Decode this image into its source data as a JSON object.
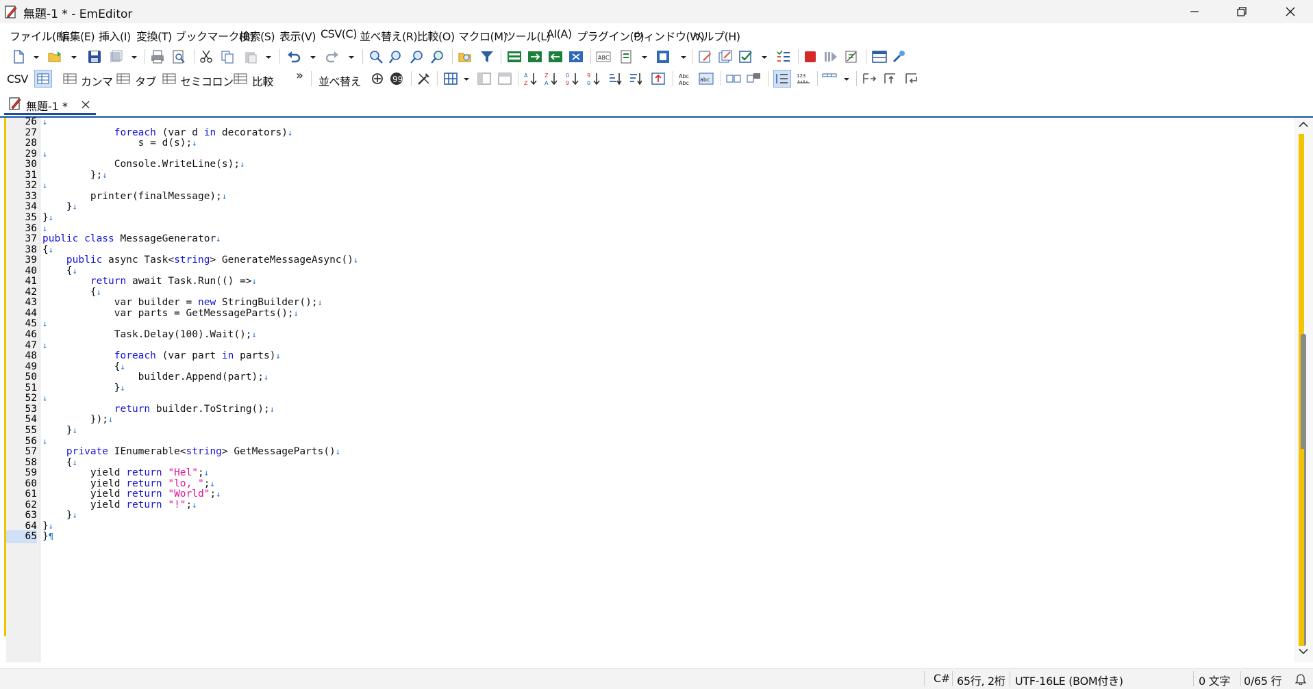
{
  "window": {
    "title": "無題-1 * - EmEditor"
  },
  "menu": [
    "ファイル(F)",
    "編集(E)",
    "挿入(I)",
    "変換(T)",
    "ブックマーク(B)",
    "検索(S)",
    "表示(V)",
    "CSV(C)",
    "並べ替え(R)",
    "比較(O)",
    "マクロ(M)",
    "ツール(L)",
    "AI(A)",
    "プラグイン(P)",
    "ウィンドウ(W)",
    "ヘルプ(H)"
  ],
  "csv_toolbar": {
    "csv_label": "CSV",
    "comma": "カンマ",
    "tab": "タブ",
    "semicolon": "セミコロン",
    "compare": "比較",
    "more": "»",
    "sort_label": "並べ替え"
  },
  "tab": {
    "label": "無題-1 *"
  },
  "editor": {
    "lines": [
      {
        "n": "26",
        "html": ""
      },
      {
        "n": "27",
        "html": "            <span class=\"kw\">foreach</span> (var d <span class=\"kw\">in</span> decorators)"
      },
      {
        "n": "28",
        "html": "                s = d(s);"
      },
      {
        "n": "29",
        "html": ""
      },
      {
        "n": "30",
        "html": "            Console.WriteLine(s);"
      },
      {
        "n": "31",
        "html": "        };"
      },
      {
        "n": "32",
        "html": ""
      },
      {
        "n": "33",
        "html": "        printer(finalMessage);"
      },
      {
        "n": "34",
        "html": "    }"
      },
      {
        "n": "35",
        "html": "}"
      },
      {
        "n": "36",
        "html": ""
      },
      {
        "n": "37",
        "html": "<span class=\"kw\">public class</span> MessageGenerator"
      },
      {
        "n": "38",
        "html": "{"
      },
      {
        "n": "39",
        "html": "    <span class=\"kw\">public</span> async Task&lt;<span class=\"kw\">string</span>&gt; GenerateMessageAsync()"
      },
      {
        "n": "40",
        "html": "    {"
      },
      {
        "n": "41",
        "html": "        <span class=\"kw\">return</span> await Task.Run(() =&gt;"
      },
      {
        "n": "42",
        "html": "        {"
      },
      {
        "n": "43",
        "html": "            var builder = <span class=\"kw\">new</span> StringBuilder();"
      },
      {
        "n": "44",
        "html": "            var parts = GetMessageParts();"
      },
      {
        "n": "45",
        "html": ""
      },
      {
        "n": "46",
        "html": "            Task.Delay(100).Wait();"
      },
      {
        "n": "47",
        "html": ""
      },
      {
        "n": "48",
        "html": "            <span class=\"kw\">foreach</span> (var part <span class=\"kw\">in</span> parts)"
      },
      {
        "n": "49",
        "html": "            {"
      },
      {
        "n": "50",
        "html": "                builder.Append(part);"
      },
      {
        "n": "51",
        "html": "            }"
      },
      {
        "n": "52",
        "html": ""
      },
      {
        "n": "53",
        "html": "            <span class=\"kw\">return</span> builder.ToString();"
      },
      {
        "n": "54",
        "html": "        });"
      },
      {
        "n": "55",
        "html": "    }"
      },
      {
        "n": "56",
        "html": ""
      },
      {
        "n": "57",
        "html": "    <span class=\"kw\">private</span> IEnumerable&lt;<span class=\"kw\">string</span>&gt; GetMessageParts()"
      },
      {
        "n": "58",
        "html": "    {"
      },
      {
        "n": "59",
        "html": "        yield <span class=\"kw\">return</span> <span class=\"str\">\"Hel\"</span>;"
      },
      {
        "n": "60",
        "html": "        yield <span class=\"kw\">return</span> <span class=\"str\">\"lo, \"</span>;"
      },
      {
        "n": "61",
        "html": "        yield <span class=\"kw\">return</span> <span class=\"str\">\"World\"</span>;"
      },
      {
        "n": "62",
        "html": "        yield <span class=\"kw\">return</span> <span class=\"str\">\"!\"</span>;"
      },
      {
        "n": "63",
        "html": "    }"
      },
      {
        "n": "64",
        "html": "}"
      },
      {
        "n": "65",
        "html": "}"
      }
    ],
    "newline_mark": "↓",
    "eof_mark": "¶",
    "current_line": "65"
  },
  "status": {
    "language": "C#",
    "position": "65行, 2桁",
    "encoding": "UTF-16LE (BOM付き)",
    "chars": "0 文字",
    "lines": "0/65 行"
  },
  "colors": {
    "keyword": "#1414d8",
    "string": "#e0109c",
    "newline_mark": "#1c6fd6",
    "modified_marker": "#f2c400",
    "accent": "#1a4fa0"
  }
}
